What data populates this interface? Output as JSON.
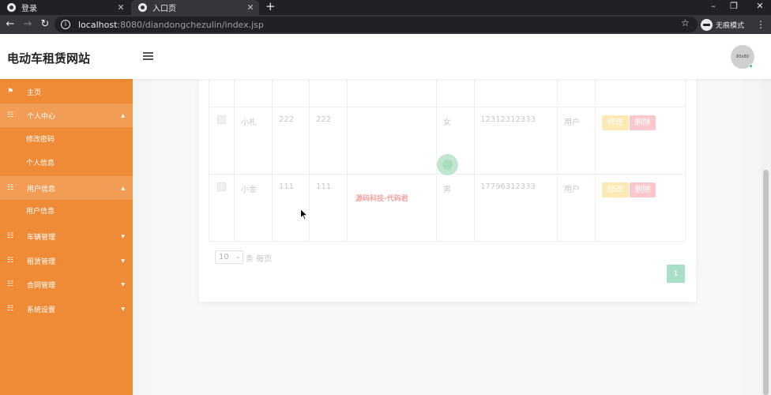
{
  "browser": {
    "tabs": [
      {
        "title": "登录",
        "active": false
      },
      {
        "title": "入口页",
        "active": true
      }
    ],
    "url_host": "localhost",
    "url_rest": ":8080/diandongchezulin/index.jsp",
    "incognito_label": "无痕模式",
    "new_tab": "+",
    "minimize": "–",
    "restore": "❐",
    "close": "✕"
  },
  "header": {
    "site_title": "电动车租赁网站",
    "avatar_text": "80x80"
  },
  "sidebar": {
    "items": [
      {
        "label": "主页",
        "icon": "flag-icon",
        "expanded": false,
        "caret": false
      },
      {
        "label": "个人中心",
        "icon": "grid-icon",
        "expanded": true,
        "caret": true,
        "children": [
          "修改密码",
          "个人信息"
        ]
      },
      {
        "label": "用户信息",
        "icon": "grid-icon",
        "expanded": true,
        "caret": true,
        "children": [
          "用户信息"
        ]
      },
      {
        "label": "车辆管理",
        "icon": "grid-icon",
        "expanded": false,
        "caret": true
      },
      {
        "label": "租赁管理",
        "icon": "grid-icon",
        "expanded": false,
        "caret": true
      },
      {
        "label": "合同管理",
        "icon": "grid-icon",
        "expanded": false,
        "caret": true
      },
      {
        "label": "系统设置",
        "icon": "grid-icon",
        "expanded": false,
        "caret": true
      }
    ]
  },
  "table": {
    "rows": [
      {
        "name": "小札",
        "col2": "222",
        "col3": "222",
        "col4": "",
        "gender": "女",
        "phone": "12312312333",
        "role": "用户"
      },
      {
        "name": "小金",
        "col2": "111",
        "col3": "111",
        "col4": "",
        "gender": "男",
        "phone": "17796312333",
        "role": "用户"
      }
    ],
    "edit_label": "修改",
    "delete_label": "删除"
  },
  "watermark": "源码科技-代码君",
  "pagination": {
    "page_size": "10",
    "per_page_label": "条 每页",
    "current_page": "1"
  },
  "colors": {
    "sidebar": "#ef8b36",
    "sidebar_expanded": "#f19d55",
    "edit_button": "#fde9b4",
    "delete_button": "#f9c7ce",
    "page_button": "#a8dfc8"
  }
}
